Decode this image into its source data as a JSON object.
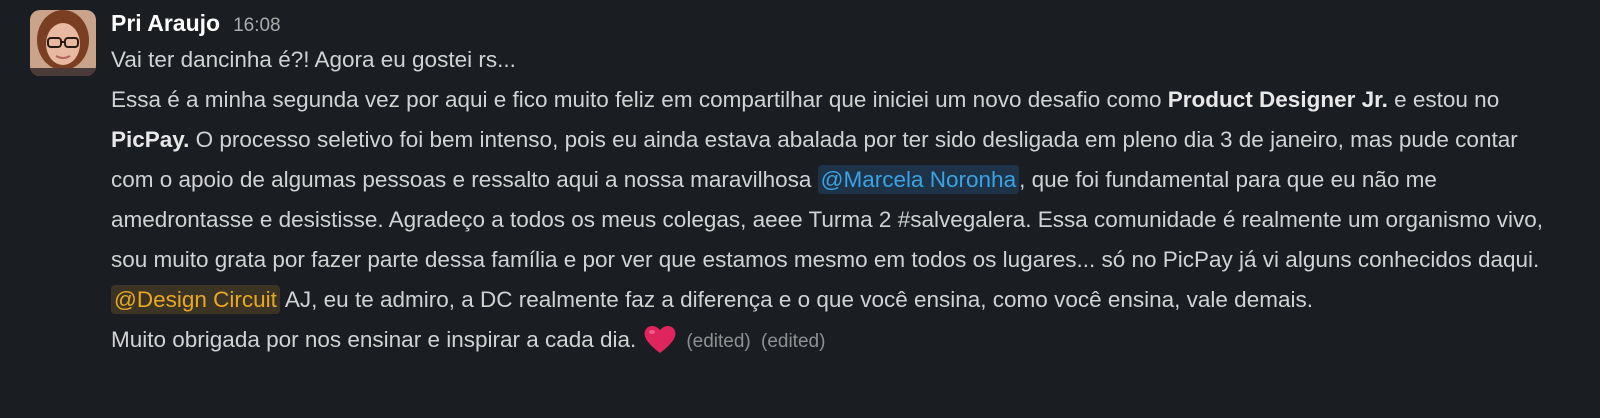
{
  "message": {
    "sender": "Pri Araujo",
    "timestamp": "16:08",
    "line1": "Vai ter dancinha é?! Agora eu gostei rs...",
    "p2_a": "Essa é a minha segunda vez por aqui e fico muito feliz em compartilhar que iniciei um novo desafio como ",
    "p2_bold1": "Product Designer Jr.",
    "p2_b": " e estou no ",
    "p2_bold2": "PicPay.",
    "p2_c": " O processo seletivo foi bem intenso, pois eu ainda estava abalada por ter sido desligada em pleno dia 3 de janeiro, mas pude contar com o apoio de algumas pessoas e ressalto aqui a nossa maravilhosa ",
    "mention1": "@Marcela Noronha",
    "p2_d": ", que foi fundamental para que eu não me amedrontasse e desistisse. Agradeço a todos os meus colegas, aeee Turma 2 #salvegalera. Essa comunidade é realmente um organismo vivo, sou muito grata por fazer parte dessa família e por ver que estamos mesmo em todos os lugares... só no PicPay já vi alguns conhecidos daqui.",
    "mention2": "@Design Circuit",
    "p3_a": " AJ, eu te admiro, a DC realmente faz a diferença e o que você ensina, como você ensina, vale demais.",
    "p4_a": "Muito obrigada por nos ensinar e inspirar a cada dia.",
    "emoji": "heart-emoji",
    "edited1": "(edited)",
    "edited2": "(edited)"
  },
  "colors": {
    "background": "#1a1d21",
    "text": "#d1d2d3",
    "mention_user": "#3aa3e3",
    "mention_group": "#e8a822",
    "heart": "#e0245e"
  }
}
